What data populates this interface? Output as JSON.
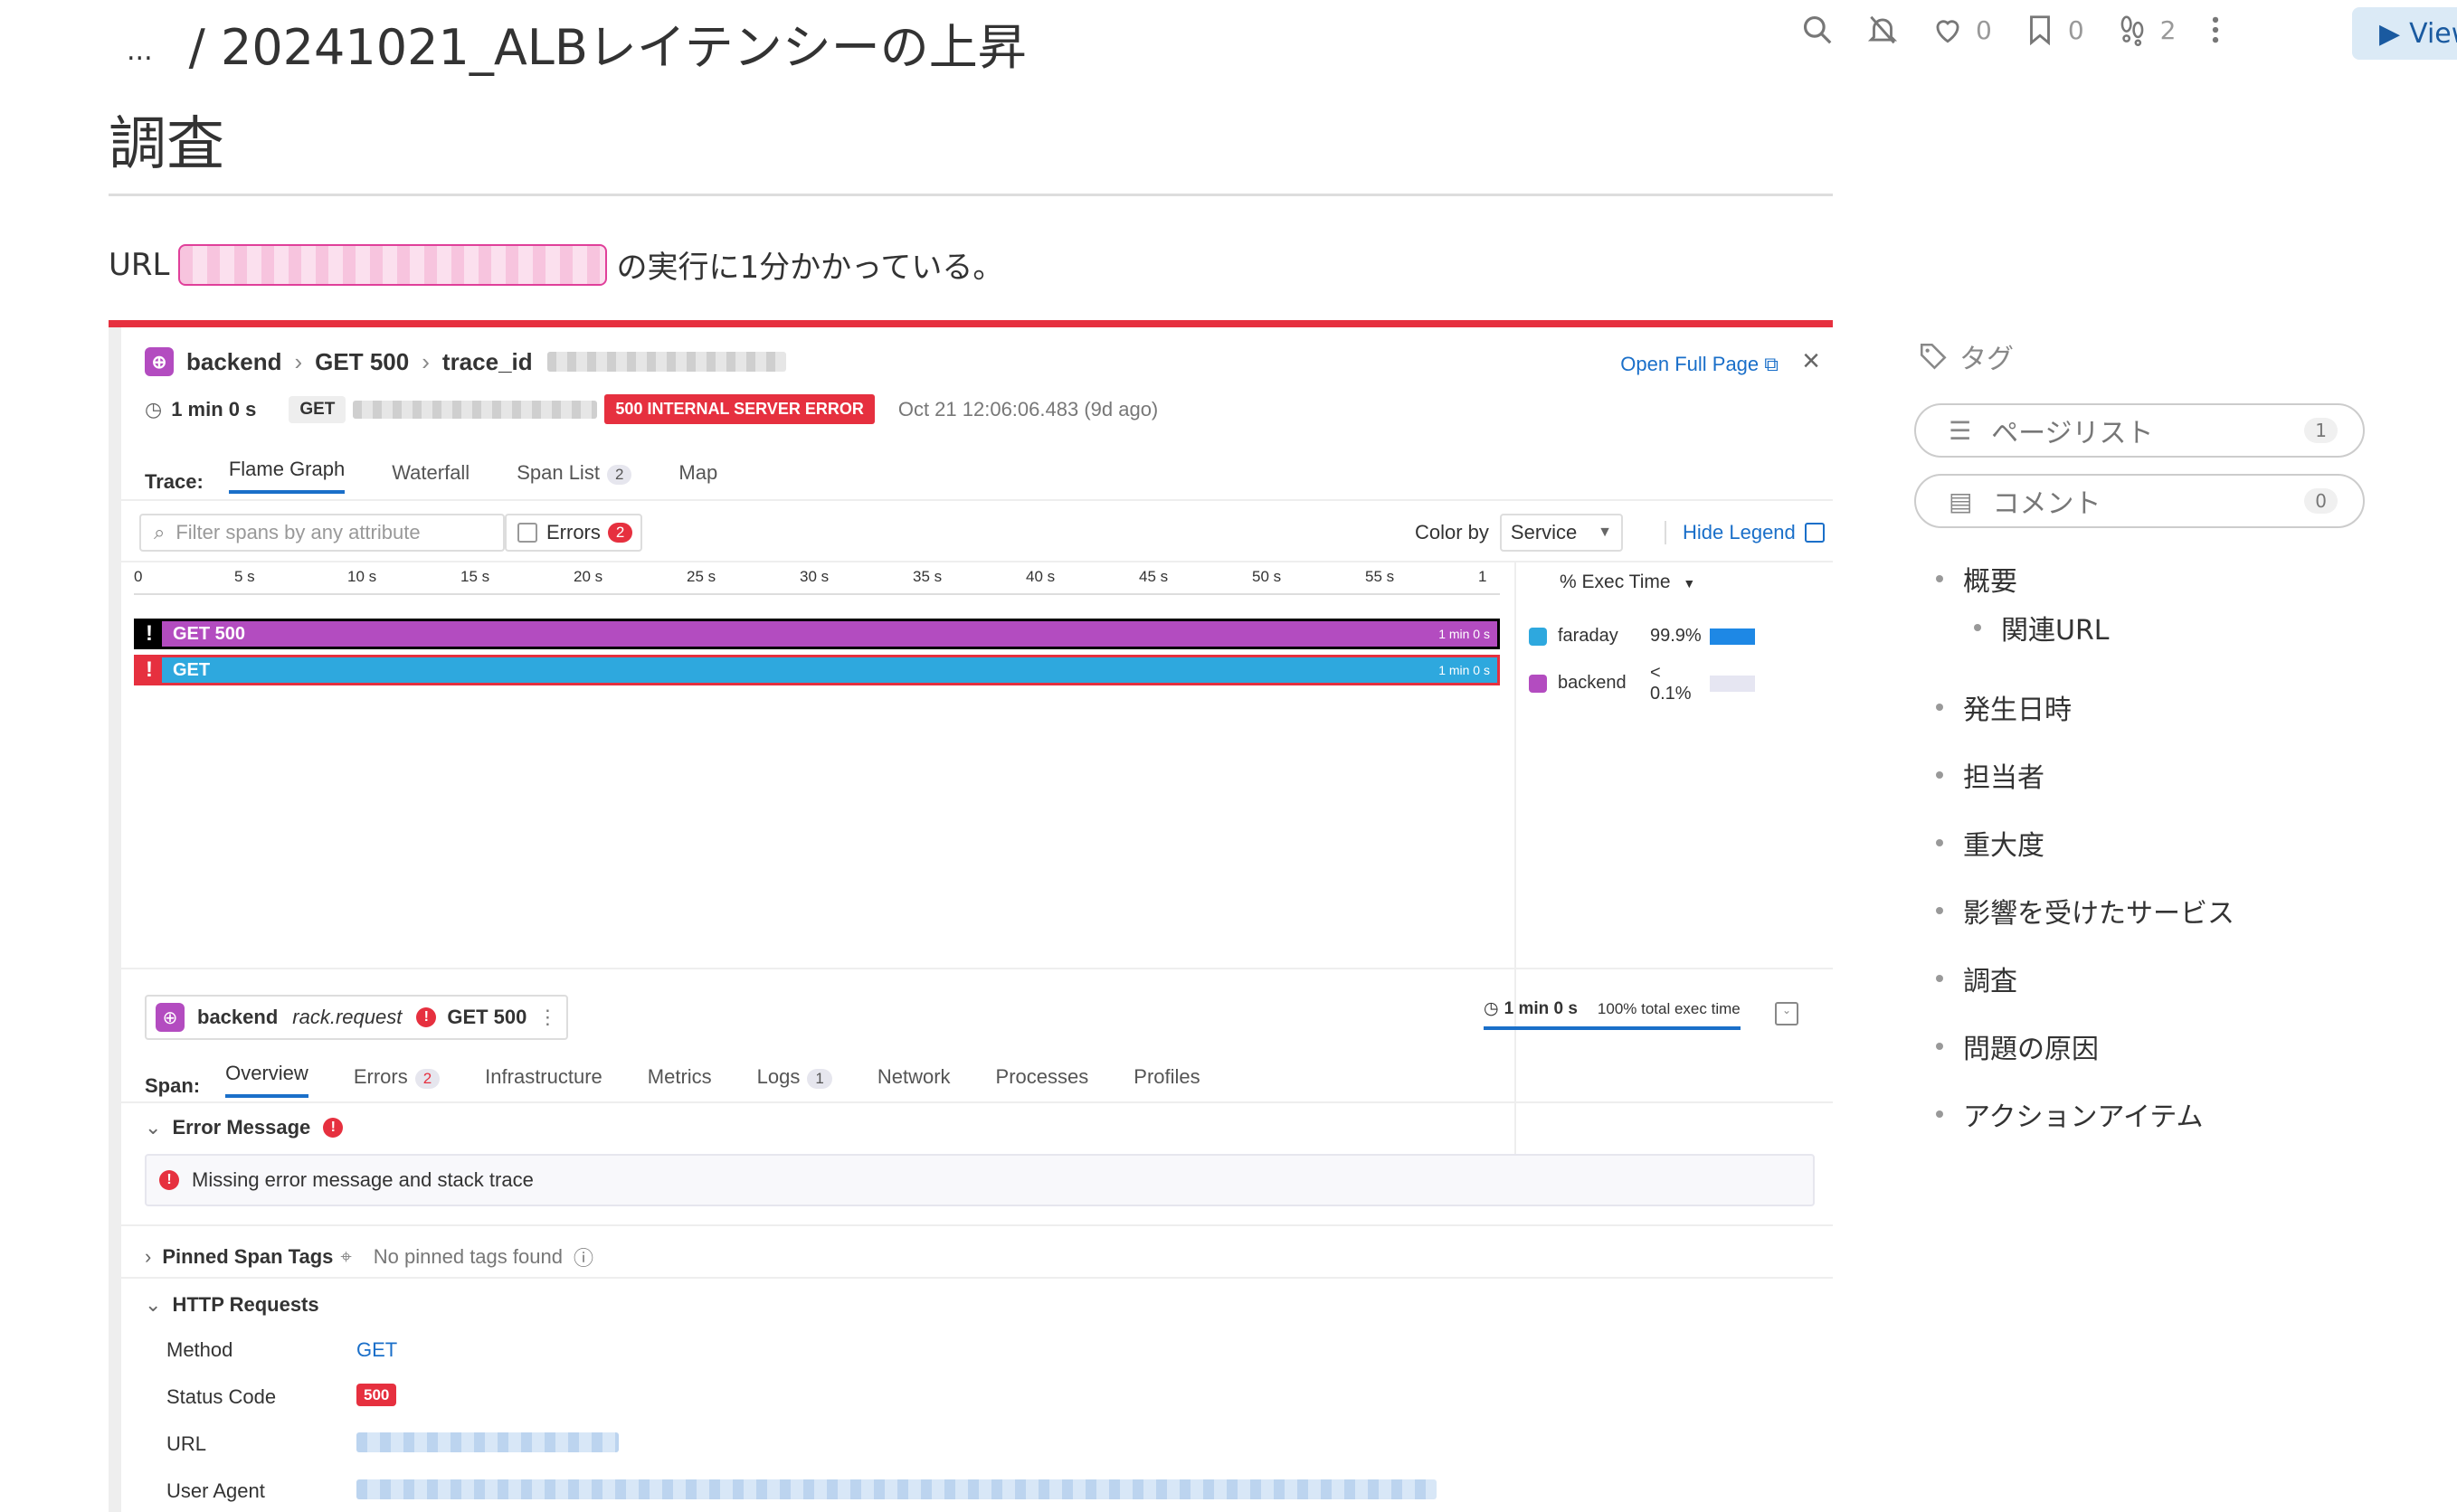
{
  "header": {
    "breadcrumb_dots": "...",
    "breadcrumb_title": "/ 20241021_ALBレイテンシーの上昇",
    "likes": "0",
    "bookmarks": "0",
    "watchers": "2",
    "view_button": "View"
  },
  "page": {
    "heading": "調査",
    "url_prefix": "URL",
    "url_suffix": "の実行に1分かかっている。"
  },
  "trace": {
    "service": "backend",
    "resource": "GET 500",
    "trace_id_label": "trace_id",
    "open_full_page": "Open Full Page",
    "duration": "1 min 0 s",
    "method_pill": "GET",
    "error_badge": "500 INTERNAL SERVER ERROR",
    "timestamp": "Oct 21 12:06:06.483 (9d ago)",
    "tabs_label": "Trace:",
    "tabs": [
      "Flame Graph",
      "Waterfall",
      "Span List",
      "Map"
    ],
    "span_list_count": "2",
    "filter_placeholder": "Filter spans by any attribute",
    "errors_label": "Errors",
    "errors_count": "2",
    "color_by_label": "Color by",
    "color_by_value": "Service",
    "hide_legend": "Hide Legend",
    "axis_ticks": [
      "0",
      "5 s",
      "10 s",
      "15 s",
      "20 s",
      "25 s",
      "30 s",
      "35 s",
      "40 s",
      "45 s",
      "50 s",
      "55 s",
      "1"
    ],
    "bars": [
      {
        "label": "GET 500",
        "duration": "1 min 0 s",
        "color": "#b34cc0"
      },
      {
        "label": "GET",
        "duration": "1 min 0 s",
        "color": "#2ea8de"
      }
    ],
    "legend_header": "% Exec Time",
    "legend": [
      {
        "name": "faraday",
        "pct": "99.9%",
        "color": "#2ea8de",
        "bar": 0.999
      },
      {
        "name": "backend",
        "pct": "< 0.1%",
        "color": "#b34cc0",
        "bar": 0.001
      }
    ]
  },
  "span": {
    "service": "backend",
    "operation": "rack.request",
    "resource": "GET 500",
    "duration": "1 min 0 s",
    "exec_pct": "100% total exec time",
    "tabs_label": "Span:",
    "tabs": [
      "Overview",
      "Errors",
      "Infrastructure",
      "Metrics",
      "Logs",
      "Network",
      "Processes",
      "Profiles"
    ],
    "errors_count": "2",
    "logs_count": "1",
    "error_message_title": "Error Message",
    "error_message": "Missing error message and stack trace",
    "pinned_title": "Pinned Span Tags",
    "pinned_empty": "No pinned tags found",
    "http_title": "HTTP Requests",
    "http": {
      "method_key": "Method",
      "method_val": "GET",
      "status_key": "Status Code",
      "status_val": "500",
      "url_key": "URL",
      "ua_key": "User Agent"
    }
  },
  "sidebar": {
    "tag_label": "タグ",
    "page_list": "ページリスト",
    "page_list_count": "1",
    "comment": "コメント",
    "comment_count": "0",
    "toc": [
      "概要",
      "関連URL",
      "発生日時",
      "担当者",
      "重大度",
      "影響を受けたサービス",
      "調査",
      "問題の原因",
      "アクションアイテム"
    ]
  }
}
